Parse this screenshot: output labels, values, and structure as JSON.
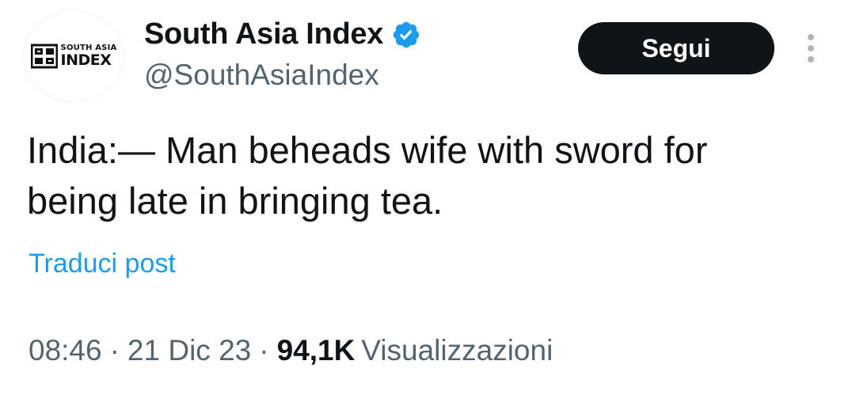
{
  "author": {
    "display_name": "South Asia Index",
    "handle": "@SouthAsiaIndex",
    "avatar_logo_small": "SOUTH ASIA",
    "avatar_logo_big": "INDEX",
    "verified_icon": "verified-badge-icon",
    "verified_color": "#1d9bf0"
  },
  "actions": {
    "follow_label": "Segui",
    "more_icon": "more-vertical-icon"
  },
  "tweet": {
    "text": "India:— Man beheads wife with sword for\nbeing late in bringing tea.",
    "translate_label": "Traduci post"
  },
  "meta": {
    "time": "08:46",
    "date": "21 Dic 23",
    "separator": "·",
    "views_count": "94,1K",
    "views_label": "Visualizzazioni"
  },
  "colors": {
    "text_primary": "#0f1419",
    "text_secondary": "#536471",
    "link": "#1d9bf0",
    "button_bg": "#0f1419"
  }
}
